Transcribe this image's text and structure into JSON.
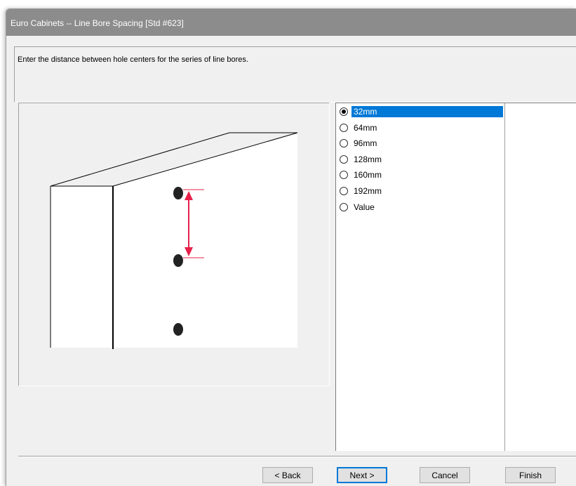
{
  "window": {
    "title": "Euro Cabinets -- Line Bore Spacing [Std #623]"
  },
  "instruction": "Enter the distance between hole centers for the series of line bores.",
  "options": [
    {
      "label": "32mm",
      "selected": true
    },
    {
      "label": "64mm",
      "selected": false
    },
    {
      "label": "96mm",
      "selected": false
    },
    {
      "label": "128mm",
      "selected": false
    },
    {
      "label": "160mm",
      "selected": false
    },
    {
      "label": "192mm",
      "selected": false
    },
    {
      "label": "Value",
      "selected": false
    }
  ],
  "buttons": {
    "back": "< Back",
    "next": "Next >",
    "cancel": "Cancel",
    "finish": "Finish"
  },
  "colors": {
    "dimension_line": "#e8204a",
    "selection": "#0078d7",
    "titlebar": "#8c8c8c"
  }
}
